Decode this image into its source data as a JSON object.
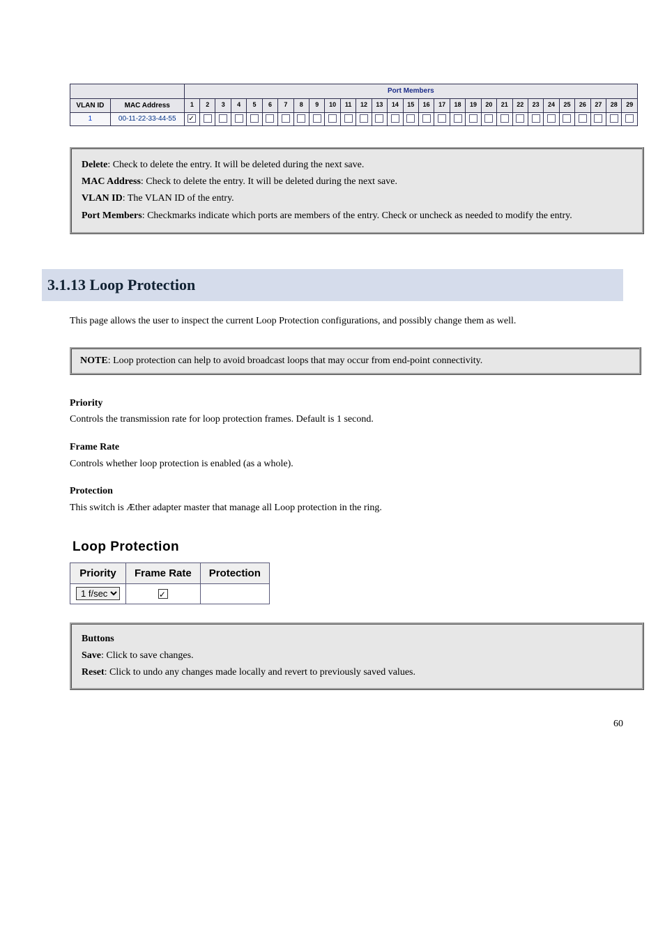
{
  "mac_table": {
    "group_header": "Port Members",
    "cols": {
      "vlan_id": "VLAN ID",
      "mac": "MAC Address"
    },
    "ports": [
      "1",
      "2",
      "3",
      "4",
      "5",
      "6",
      "7",
      "8",
      "9",
      "10",
      "11",
      "12",
      "13",
      "14",
      "15",
      "16",
      "17",
      "18",
      "19",
      "20",
      "21",
      "22",
      "23",
      "24",
      "25",
      "26",
      "27",
      "28",
      "29"
    ],
    "row": {
      "vlan_id": "1",
      "mac": "00-11-22-33-44-55",
      "checked": [
        true,
        false,
        false,
        false,
        false,
        false,
        false,
        false,
        false,
        false,
        false,
        false,
        false,
        false,
        false,
        false,
        false,
        false,
        false,
        false,
        false,
        false,
        false,
        false,
        false,
        false,
        false,
        false,
        false
      ]
    }
  },
  "def_box": {
    "delete_term": "Delete",
    "delete_desc": ": Check to delete the entry. It will be deleted during the next save.",
    "mac_term": "MAC Address",
    "mac_desc": ": Check to delete the entry. It will be deleted during the next save.",
    "sub1_term": "VLAN ID",
    "sub1_desc": ": The VLAN ID of the entry.",
    "sub2_term": "Port Members",
    "sub2_desc": ": Checkmarks indicate which ports are members of the entry. Check or uncheck as needed to modify the entry."
  },
  "section_title": "3.1.13 Loop Protection",
  "intro_para": "This page allows the user to inspect the current Loop Protection configurations, and possibly change them as well.",
  "note": {
    "label": "NOTE",
    "text": ": Loop protection can help to avoid broadcast loops that may occur from end-point connectivity."
  },
  "params": {
    "priority_h": "Priority",
    "priority_b": "Controls the transmission rate for loop protection frames. Default is 1 second.",
    "framerate_h": "Frame Rate",
    "framerate_b": "Controls whether loop protection is enabled (as a whole).",
    "protection_h": "Protection",
    "protection_b": "This switch is Æther adapter master that manage all Loop protection in the ring."
  },
  "lpanel": {
    "title": "Loop Protection",
    "col_priority": "Priority",
    "col_framerate": "Frame Rate",
    "col_protection": "Protection",
    "select_value": "1 f/sec",
    "frame_checked": true,
    "protection_checked": false
  },
  "buttons_box": {
    "btn_label": "Buttons",
    "save_name": "Save",
    "save_desc": ": Click to save changes.",
    "reset_name": "Reset",
    "reset_desc": ": Click to undo any changes made locally and revert to previously saved values."
  },
  "footer_page": "60"
}
